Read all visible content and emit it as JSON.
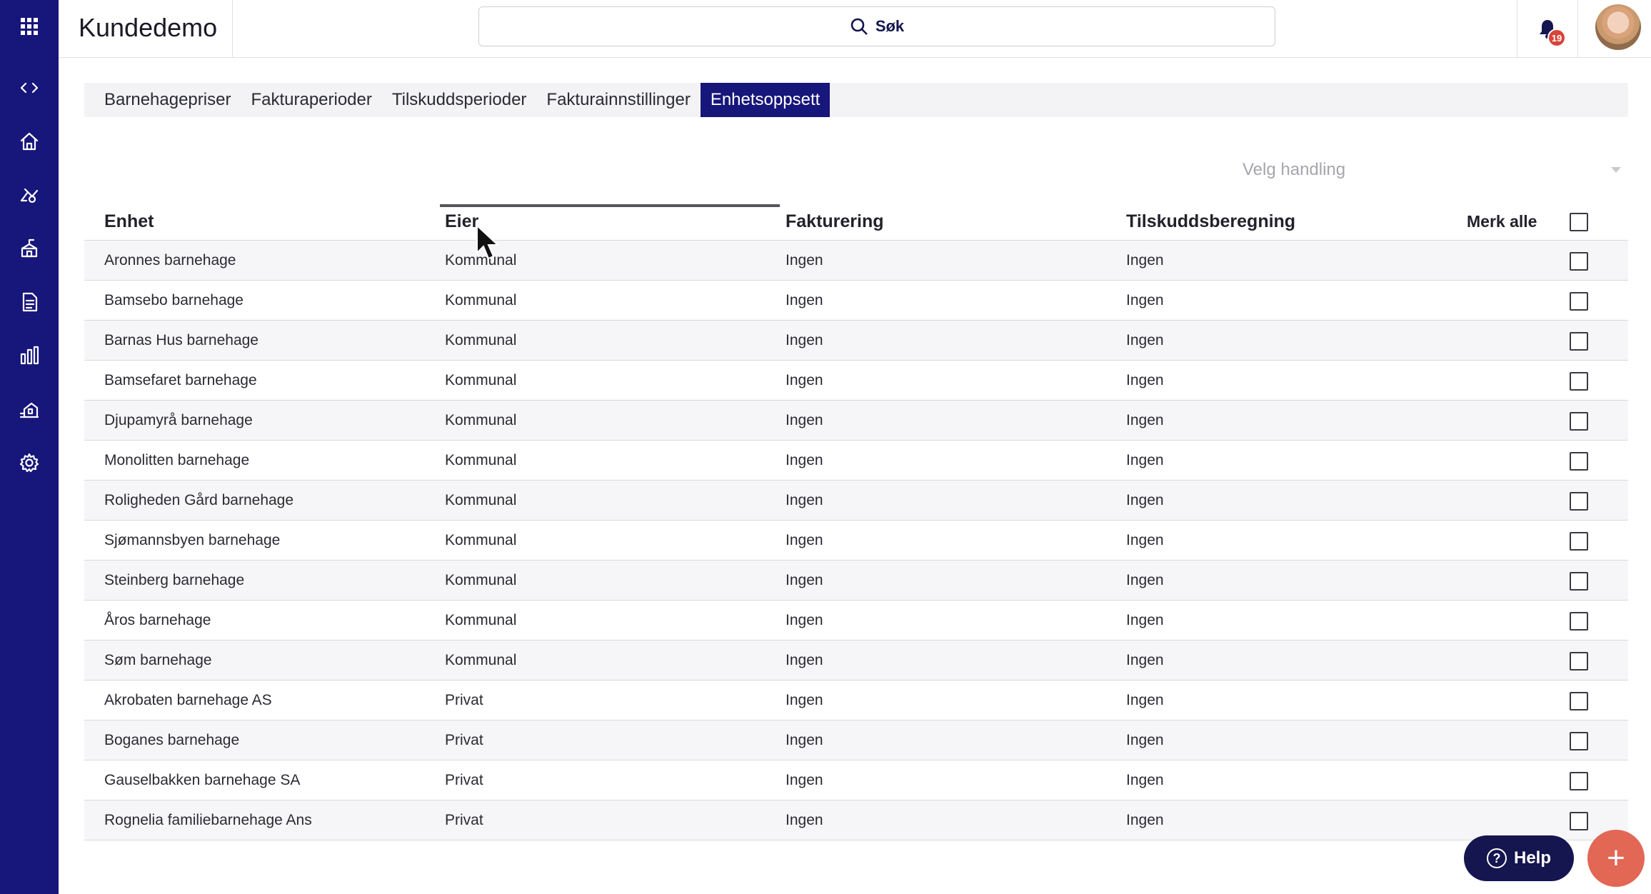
{
  "app": {
    "title": "Kundedemo"
  },
  "search": {
    "label": "Søk"
  },
  "notifications": {
    "count": "19"
  },
  "sidebar": {
    "icons": [
      "apps-grid-icon",
      "code-icon",
      "home-icon",
      "children-icon",
      "school-icon",
      "document-icon",
      "bar-chart-icon",
      "building-icon",
      "settings-icon"
    ]
  },
  "tabs": [
    {
      "label": "Barnehagepriser",
      "active": false
    },
    {
      "label": "Fakturaperioder",
      "active": false
    },
    {
      "label": "Tilskuddsperioder",
      "active": false
    },
    {
      "label": "Fakturainnstillinger",
      "active": false
    },
    {
      "label": "Enhetsoppsett",
      "active": true
    }
  ],
  "action_select": {
    "placeholder": "Velg handling"
  },
  "table": {
    "headers": {
      "enhet": "Enhet",
      "eier": "Eier",
      "fakturering": "Fakturering",
      "tilskudd": "Tilskuddsberegning",
      "merk_alle": "Merk alle"
    },
    "rows": [
      {
        "enhet": "Aronnes barnehage",
        "eier": "Kommunal",
        "fakturering": "Ingen",
        "tilskudd": "Ingen"
      },
      {
        "enhet": "Bamsebo barnehage",
        "eier": "Kommunal",
        "fakturering": "Ingen",
        "tilskudd": "Ingen"
      },
      {
        "enhet": "Barnas Hus barnehage",
        "eier": "Kommunal",
        "fakturering": "Ingen",
        "tilskudd": "Ingen"
      },
      {
        "enhet": "Bamsefaret barnehage",
        "eier": "Kommunal",
        "fakturering": "Ingen",
        "tilskudd": "Ingen"
      },
      {
        "enhet": "Djupamyrå barnehage",
        "eier": "Kommunal",
        "fakturering": "Ingen",
        "tilskudd": "Ingen"
      },
      {
        "enhet": "Monolitten barnehage",
        "eier": "Kommunal",
        "fakturering": "Ingen",
        "tilskudd": "Ingen"
      },
      {
        "enhet": "Roligheden Gård barnehage",
        "eier": "Kommunal",
        "fakturering": "Ingen",
        "tilskudd": "Ingen"
      },
      {
        "enhet": "Sjømannsbyen barnehage",
        "eier": "Kommunal",
        "fakturering": "Ingen",
        "tilskudd": "Ingen"
      },
      {
        "enhet": "Steinberg barnehage",
        "eier": "Kommunal",
        "fakturering": "Ingen",
        "tilskudd": "Ingen"
      },
      {
        "enhet": "Åros barnehage",
        "eier": "Kommunal",
        "fakturering": "Ingen",
        "tilskudd": "Ingen"
      },
      {
        "enhet": "Søm barnehage",
        "eier": "Kommunal",
        "fakturering": "Ingen",
        "tilskudd": "Ingen"
      },
      {
        "enhet": "Akrobaten barnehage AS",
        "eier": "Privat",
        "fakturering": "Ingen",
        "tilskudd": "Ingen"
      },
      {
        "enhet": "Boganes barnehage",
        "eier": "Privat",
        "fakturering": "Ingen",
        "tilskudd": "Ingen"
      },
      {
        "enhet": "Gauselbakken barnehage SA",
        "eier": "Privat",
        "fakturering": "Ingen",
        "tilskudd": "Ingen"
      },
      {
        "enhet": "Rognelia familiebarnehage Ans",
        "eier": "Privat",
        "fakturering": "Ingen",
        "tilskudd": "Ingen"
      }
    ]
  },
  "help_button": {
    "label": "Help"
  },
  "add_button": {
    "icon": "plus-icon"
  },
  "colors": {
    "brand": "#17167a",
    "accent": "#e26755",
    "badge": "#d8443a"
  }
}
